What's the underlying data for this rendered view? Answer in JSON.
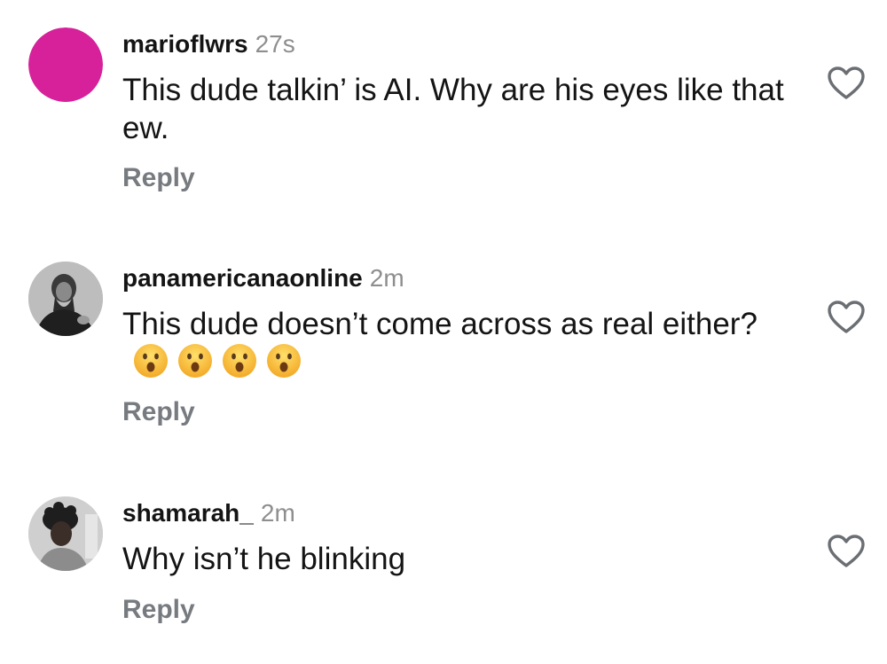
{
  "comments": [
    {
      "username": "marioflwrs",
      "time": "27s",
      "text": "This dude talkin’ is AI. Why are his eyes like that ew.",
      "reply_label": "Reply",
      "avatar_color": "#d6219b"
    },
    {
      "username": "panamericanaonline",
      "time": "2m",
      "text": "This dude doesn’t come across as real either?",
      "emoji": [
        "😮",
        "😮",
        "😮",
        "😮"
      ],
      "reply_label": "Reply"
    },
    {
      "username": "shamarah_",
      "time": "2m",
      "text": "Why isn’t he blinking",
      "reply_label": "Reply"
    }
  ],
  "icons": {
    "like": "heart-outline-icon",
    "surprised": "face-with-open-mouth-icon"
  },
  "colors": {
    "username": "#141414",
    "muted": "#8e8e8e",
    "reply": "#777b80",
    "emoji": "#f7c531"
  }
}
